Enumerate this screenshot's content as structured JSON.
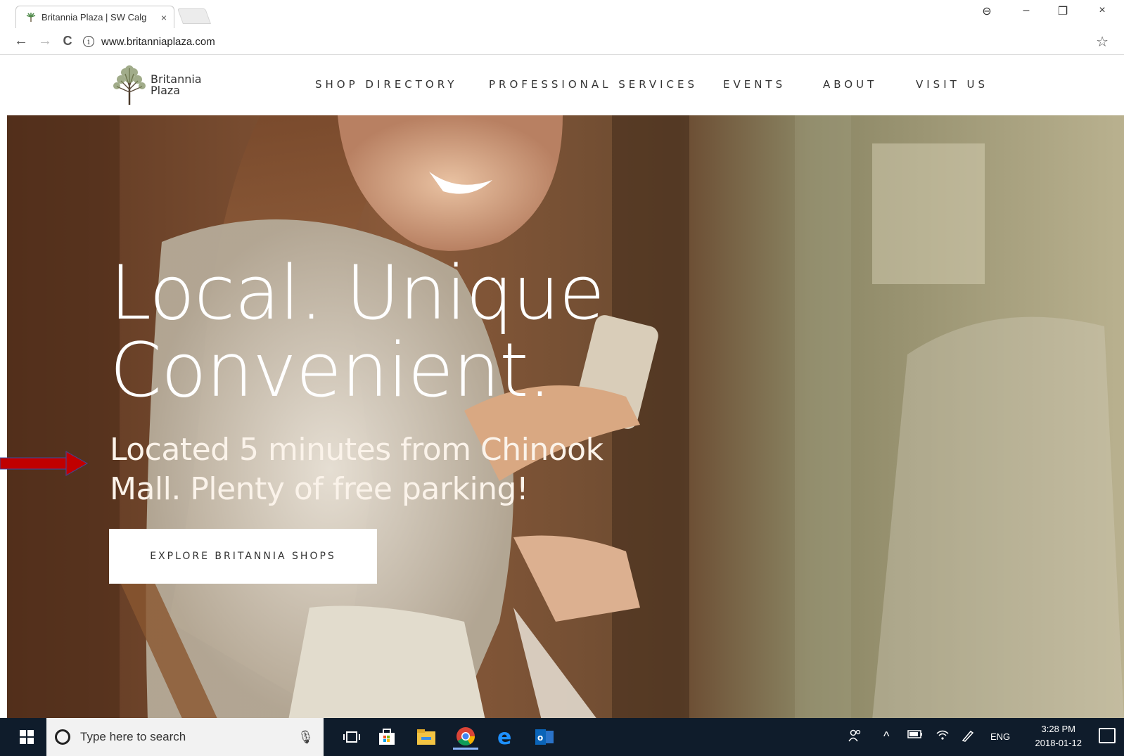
{
  "browser": {
    "tab_title": "Britannia Plaza | SW Calg",
    "tab_close": "×",
    "url": "www.britanniaplaza.com",
    "info_glyph": "i",
    "back": "←",
    "forward": "→",
    "reload": "C",
    "star": "☆",
    "account": "⊖",
    "minimize": "–",
    "restore": "❐",
    "close": "×"
  },
  "site": {
    "logo_line1": "Britannia",
    "logo_line2": "Plaza",
    "nav": [
      "SHOP DIRECTORY",
      "PROFESSIONAL SERVICES",
      "EVENTS",
      "ABOUT",
      "VISIT US"
    ]
  },
  "hero": {
    "title_line1": "Local. Unique",
    "title_line2": "Convenient.",
    "subtitle_line1": "Located 5 minutes from Chinook",
    "subtitle_line2": "Mall. Plenty of free parking!",
    "cta_label": "EXPLORE BRITANNIA SHOPS"
  },
  "annotation": {
    "arrow_color": "#c00000"
  },
  "taskbar": {
    "search_placeholder": "Type here to search",
    "mic": "🎙",
    "language": "ENG",
    "time": "3:28 PM",
    "date": "2018-01-12",
    "tray_up": "^"
  },
  "colors": {
    "taskbar": "#0f1c2b",
    "hero_bg": "#6f4a30"
  }
}
